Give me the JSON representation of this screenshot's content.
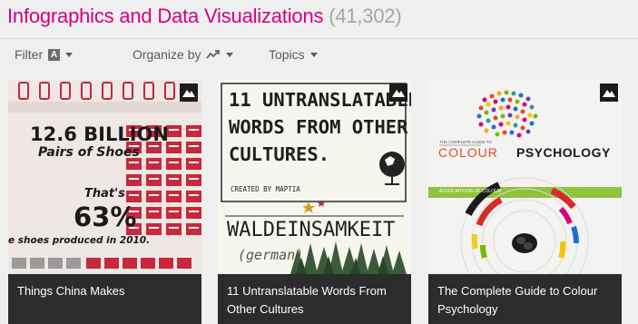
{
  "header": {
    "title": "Infographics and Data Visualizations",
    "count": "(41,302)"
  },
  "toolbar": {
    "filter_label": "Filter",
    "filter_badge": "A",
    "organize_label": "Organize by",
    "topics_label": "Topics"
  },
  "cards": [
    {
      "caption": "Things China Makes",
      "thumb": {
        "line1": "12.6 BILLION",
        "line2": "Pairs of Shoes",
        "line3": "That's",
        "line4": "63%",
        "line5": "e shoes produced in 2010."
      }
    },
    {
      "caption": "11 Untranslatable Words From Other Cultures",
      "thumb": {
        "line1": "11 UNTRANSLATABLE",
        "line2": "WORDS FROM OTHER",
        "line3": "CULTURES.",
        "credit": "CREATED BY MAPTIA",
        "word": "WALDEINSAMKEIT",
        "lang": "(german)"
      }
    },
    {
      "caption": "The Complete Guide to Colour Psychology",
      "thumb": {
        "kicker": "THE COMPLETE GUIDE TO",
        "colour": "COLOUR",
        "psychology": "PSYCHOLOGY",
        "section": "ASSOCIATIONS OF COLOUR"
      }
    }
  ],
  "colors": {
    "title": "#d5007f",
    "count": "#a6a6a6",
    "caption_bg": "#2c2c2c",
    "shoe_red": "#c0283a",
    "tree_green": "#3b5a3a"
  }
}
